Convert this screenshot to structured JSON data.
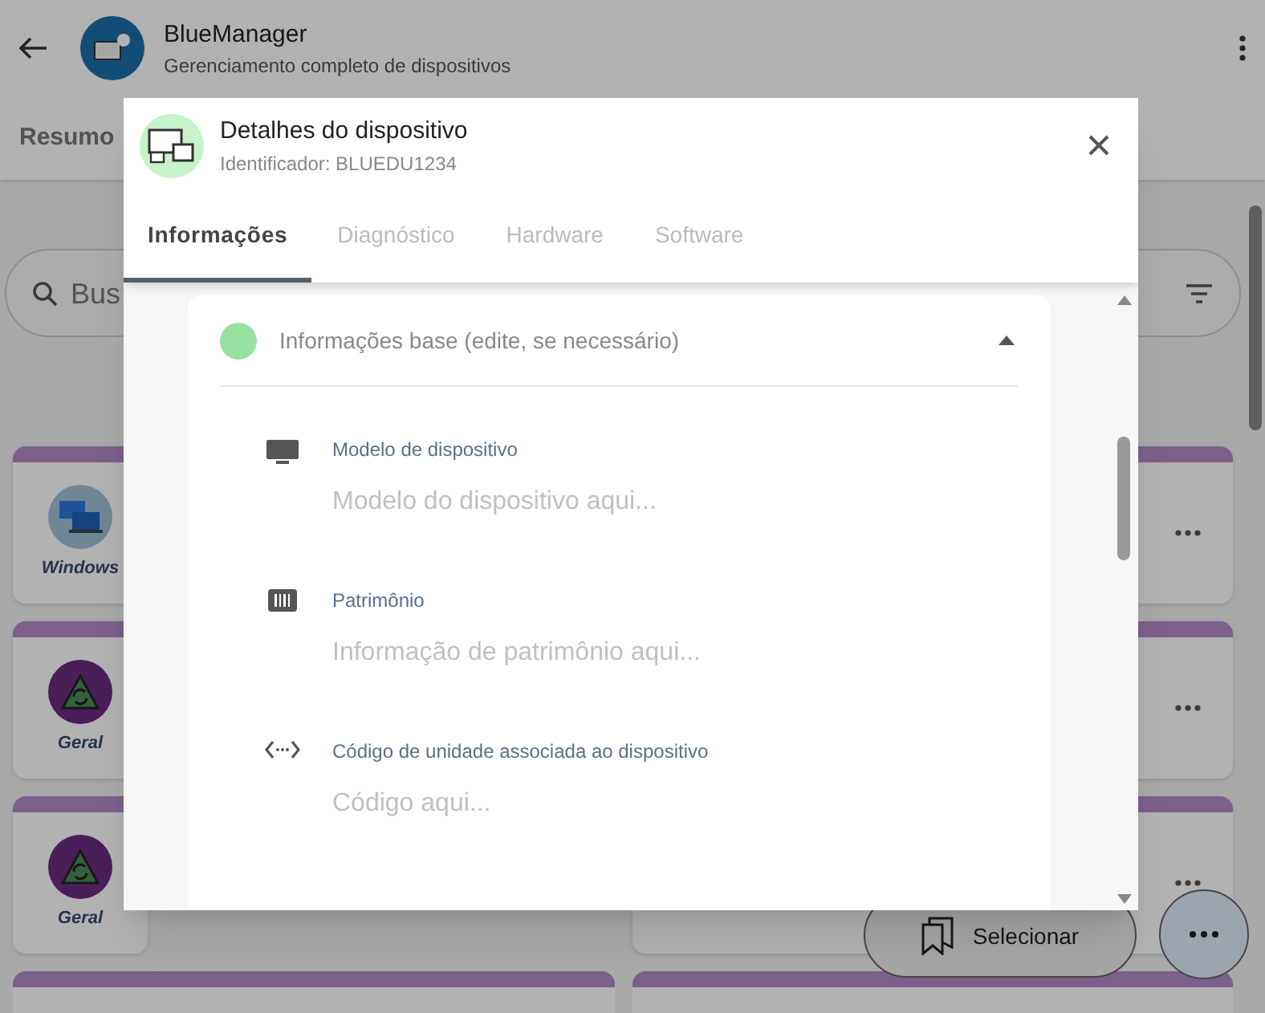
{
  "app_bar": {
    "title": "BlueManager",
    "subtitle": "Gerenciamento completo de dispositivos"
  },
  "nav_tabs": [
    "Resumo"
  ],
  "search": {
    "placeholder": "Bus"
  },
  "device_cards": [
    {
      "label": "Windows",
      "kind": "windows"
    },
    {
      "label": "Geral",
      "kind": "geral"
    },
    {
      "label": "Geral",
      "kind": "geral"
    }
  ],
  "select_button": {
    "label": "Selecionar"
  },
  "dialog": {
    "title": "Detalhes do dispositivo",
    "subtitle": "Identificador: BLUEDU1234",
    "tabs": [
      {
        "label": "Informações",
        "selected": true
      },
      {
        "label": "Diagnóstico",
        "selected": false
      },
      {
        "label": "Hardware",
        "selected": false
      },
      {
        "label": "Software",
        "selected": false
      }
    ],
    "section": {
      "title": "Informações base (edite, se necessário)",
      "expanded": true,
      "color": "#98e0a0",
      "fields": [
        {
          "kind": "monitor",
          "label": "Modelo de dispositivo",
          "placeholder": "Modelo do dispositivo aqui..."
        },
        {
          "kind": "barcode",
          "label": "Patrimônio",
          "placeholder": "Informação de patrimônio aqui..."
        },
        {
          "kind": "code",
          "label": "Código de unidade associada ao dispositivo",
          "placeholder": "Código aqui..."
        }
      ]
    }
  }
}
